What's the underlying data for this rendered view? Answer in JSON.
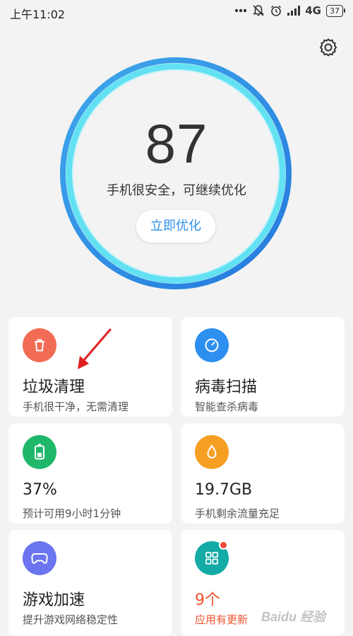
{
  "status": {
    "time": "上午11:02",
    "network": "4G",
    "battery": "37",
    "icons": [
      "more-dots-icon",
      "mute-icon",
      "alarm-icon",
      "signal-icon",
      "network-4g-icon",
      "battery-icon"
    ]
  },
  "score": {
    "value": "87",
    "message": "手机很安全，可继续优化",
    "button_label": "立即优化"
  },
  "cards": [
    {
      "title": "垃圾清理",
      "subtitle": "手机很干净，无需清理",
      "icon": "trash-icon",
      "color": "#f26b54"
    },
    {
      "title": "病毒扫描",
      "subtitle": "智能查杀病毒",
      "icon": "scan-gauge-icon",
      "color": "#2d8ff0"
    },
    {
      "title": "37%",
      "subtitle": "预计可用9小时1分钟",
      "icon": "battery-icon",
      "color": "#1fb86a"
    },
    {
      "title": "19.7GB",
      "subtitle": "手机剩余流量充足",
      "icon": "data-drop-icon",
      "color": "#f59f22"
    },
    {
      "title": "游戏加速",
      "subtitle": "提升游戏网络稳定性",
      "icon": "gamepad-icon",
      "color": "#6b75f0"
    },
    {
      "title": "9个",
      "subtitle": "应用有更新",
      "icon": "apps-grid-icon",
      "color": "#14aaa6",
      "title_color": "#f0532d"
    }
  ],
  "colors": {
    "ring_outer": "#2f8ee5",
    "ring_inner": "#5fe0f0",
    "accent": "#2f8fe8",
    "arrow": "#e02020"
  },
  "watermark": "Baidu 经验"
}
